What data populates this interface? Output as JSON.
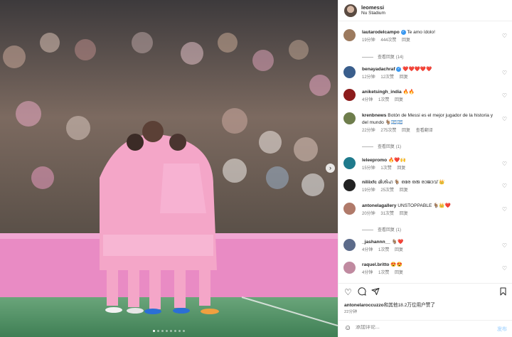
{
  "post": {
    "username": "leomessi",
    "location": "Nu Stadium",
    "likes_prefix": "antonelaroccuzzo",
    "likes_suffix": "和其他18.2万位用户赞了",
    "time": "22分钟"
  },
  "comments": [
    {
      "user": "lautarodelcampo",
      "verified": true,
      "text": "Te amo ídolo!",
      "time": "19分钟",
      "likes": "444次赞",
      "reply": "回复",
      "view_replies": "查看回复 (14)",
      "avatar_color": "#9c7a5e"
    },
    {
      "user": "benayadachraf",
      "verified": true,
      "text": "❤️❤️❤️❤️❤️",
      "time": "12分钟",
      "likes": "12次赞",
      "reply": "回复",
      "avatar_color": "#3a5e8c"
    },
    {
      "user": "aniketsingh_india",
      "verified": false,
      "text": "🔥🔥",
      "time": "4分钟",
      "likes": "1次赞",
      "reply": "回复",
      "avatar_color": "#8c1c1c"
    },
    {
      "user": "krenbnews",
      "verified": false,
      "text": "Botón de Messi es el mejor jugador de la historia y del mundo 🐐🇦🇷🇦🇷",
      "time": "22分钟",
      "likes": "275次赞",
      "reply": "回复",
      "translate": "查看翻译",
      "view_replies": "查看回复 (1)",
      "avatar_color": "#6e7d4c"
    },
    {
      "user": "leleepromo",
      "verified": false,
      "text": "🔥❤️🙌",
      "time": "15分钟",
      "likes": "1次赞",
      "reply": "回复",
      "avatar_color": "#1f7a8c"
    },
    {
      "user": "niliixfc",
      "verified": false,
      "text": "മിശിഹ 🐐 ഒരേ ഒരു രാജാവ് 👑",
      "time": "19分钟",
      "likes": "25次赞",
      "reply": "回复",
      "avatar_color": "#222222"
    },
    {
      "user": "antonelagallery",
      "verified": false,
      "text": "UNSTOPPABLE 🐐👑❤️",
      "time": "20分钟",
      "likes": "31次赞",
      "reply": "回复",
      "view_replies": "查看回复 (1)",
      "avatar_color": "#b07a6a"
    },
    {
      "user": "_jashannn__",
      "verified": false,
      "text": "🐐❤️",
      "time": "4分钟",
      "likes": "1次赞",
      "reply": "回复",
      "avatar_color": "#5c6b8a"
    },
    {
      "user": "raquel.britto",
      "verified": false,
      "text": "😍😍",
      "time": "4分钟",
      "likes": "1次赞",
      "reply": "回复",
      "avatar_color": "#c08aa0"
    }
  ],
  "add_comment": {
    "placeholder": "添加评论...",
    "post_label": "发布"
  },
  "icons": {
    "like": "heart-icon",
    "comment": "comment-icon",
    "share": "send-icon",
    "save": "bookmark-icon",
    "emoji": "emoji-icon",
    "next": "chevron-right-icon"
  },
  "photo": {
    "slide_count": 8,
    "active_slide": 1
  }
}
